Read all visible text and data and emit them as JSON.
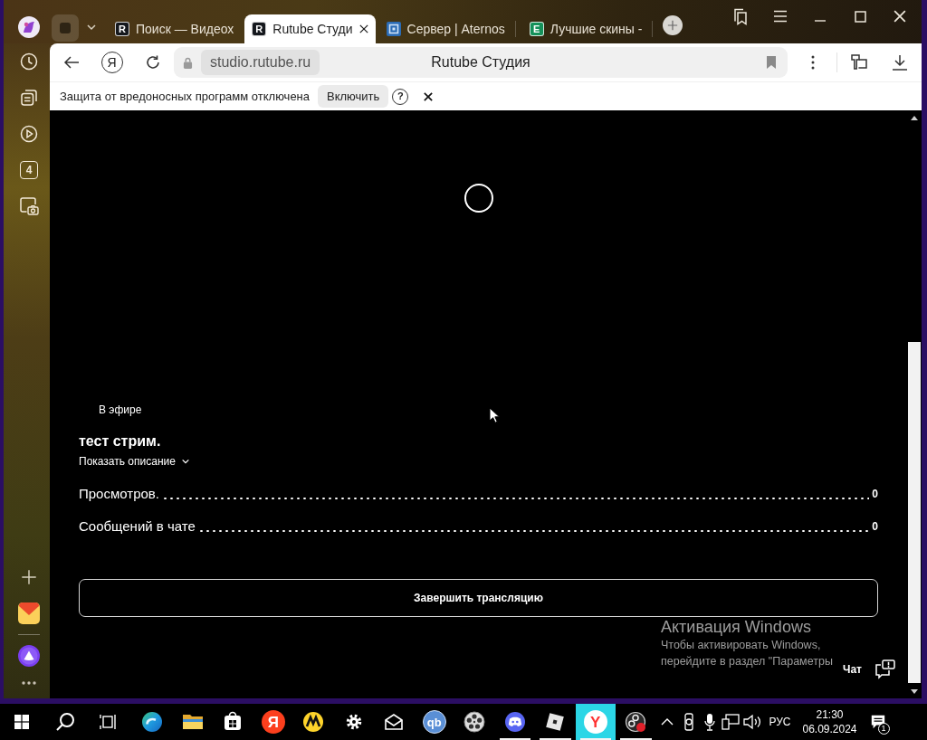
{
  "browser": {
    "tabs": [
      {
        "title": "Поиск — Видеох",
        "selected": false,
        "favicon": {
          "kind": "letter",
          "text": "R",
          "color": "#15181d"
        }
      },
      {
        "title": "Rutube Студи",
        "selected": true,
        "favicon": {
          "kind": "letter",
          "text": "R",
          "color": "#15181d"
        }
      },
      {
        "title": "Сервер | Aternos",
        "selected": false,
        "favicon": {
          "kind": "grid",
          "color": "#2b6cb5"
        }
      },
      {
        "title": "Лучшие скины -",
        "selected": false,
        "favicon": {
          "kind": "letter",
          "text": "E",
          "color": "#15915a"
        }
      }
    ],
    "address": {
      "home_label": "Я",
      "url": "studio.rutube.ru",
      "page_title": "Rutube Студия"
    },
    "infobar": {
      "message": "Защита от вредоносных программ отключена",
      "action": "Включить",
      "help_label": "?"
    },
    "sidebar": {
      "tab_count": "4"
    }
  },
  "stream": {
    "status": "В эфире",
    "title": "тест стрим.",
    "description_toggle": "Показать описание",
    "expanded": false,
    "stats": [
      {
        "label": "Просмотров.",
        "value": "0"
      },
      {
        "label": "Сообщений в чате",
        "value": "0"
      }
    ],
    "end_button": "Завершить трансляцию",
    "chat_button": "Чат"
  },
  "windows_activation": {
    "title": "Активация Windows",
    "lines": [
      "Чтобы активировать Windows,",
      "перейдите в раздел \"Параметры"
    ]
  },
  "taskbar": {
    "apps": [
      {
        "kind": "edge",
        "running": false,
        "selected": false
      },
      {
        "kind": "explorer",
        "running": false,
        "selected": false
      },
      {
        "kind": "store",
        "running": false,
        "selected": false
      },
      {
        "kind": "yandex",
        "label": "Я",
        "running": false,
        "selected": false
      },
      {
        "kind": "market",
        "running": false,
        "selected": false
      },
      {
        "kind": "settings",
        "running": false,
        "selected": false
      },
      {
        "kind": "mail",
        "running": false,
        "selected": false
      },
      {
        "kind": "qbittorrent",
        "label": "qb",
        "running": false,
        "selected": false
      },
      {
        "kind": "reel",
        "running": false,
        "selected": false
      },
      {
        "kind": "discord",
        "running": true,
        "selected": false
      },
      {
        "kind": "roblox",
        "running": true,
        "selected": false
      },
      {
        "kind": "ybrowser",
        "label": "Y",
        "running": true,
        "selected": true
      },
      {
        "kind": "obs",
        "running": true,
        "selected": false
      }
    ],
    "language": "РУС",
    "time": "21:30",
    "date": "06.09.2024",
    "notification_count": "1"
  }
}
